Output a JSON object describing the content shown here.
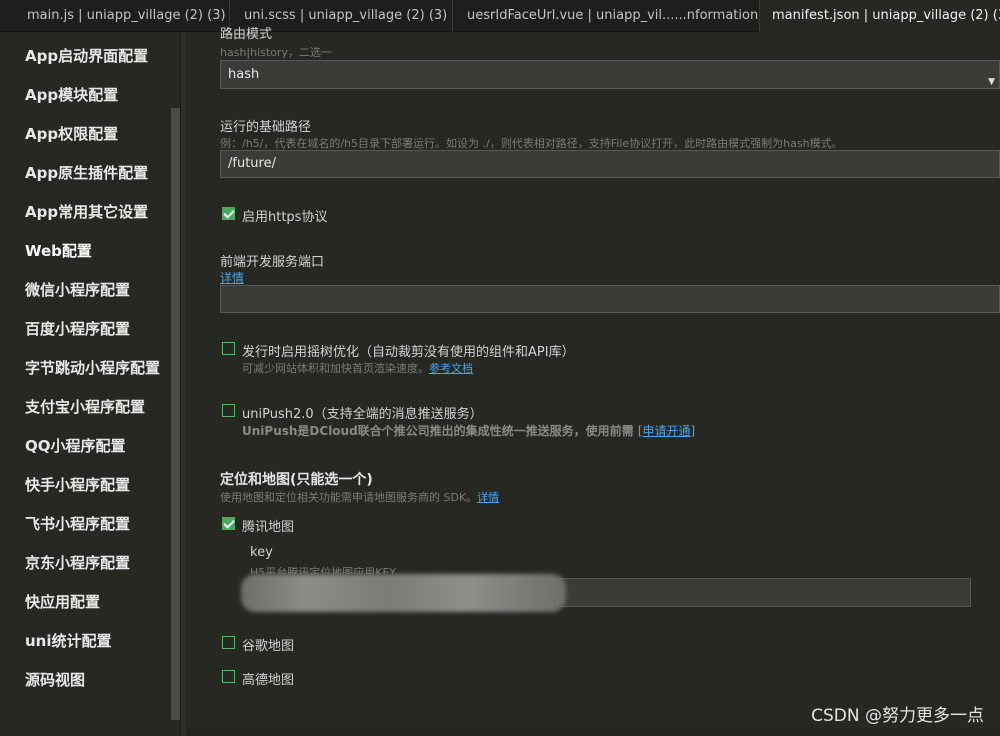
{
  "tabs": [
    {
      "label": "main.js | uniapp_village (2) (3)"
    },
    {
      "label": "uni.scss | uniapp_village (2) (3)"
    },
    {
      "label": "uesrIdFaceUrl.vue | uniapp_vil......nformation"
    },
    {
      "label": "manifest.json | uniapp_village (2) (3)"
    }
  ],
  "sidebar": {
    "items": [
      {
        "label": "App启动界面配置"
      },
      {
        "label": "App模块配置"
      },
      {
        "label": "App权限配置"
      },
      {
        "label": "App原生插件配置"
      },
      {
        "label": "App常用其它设置"
      },
      {
        "label": "Web配置"
      },
      {
        "label": "微信小程序配置"
      },
      {
        "label": "百度小程序配置"
      },
      {
        "label": "字节跳动小程序配置"
      },
      {
        "label": "支付宝小程序配置"
      },
      {
        "label": "QQ小程序配置"
      },
      {
        "label": "快手小程序配置"
      },
      {
        "label": "飞书小程序配置"
      },
      {
        "label": "京东小程序配置"
      },
      {
        "label": "快应用配置"
      },
      {
        "label": "uni统计配置"
      },
      {
        "label": "源码视图"
      }
    ]
  },
  "form": {
    "router_mode": {
      "label": "路由模式",
      "hint": "hash|history，二选一",
      "value": "hash"
    },
    "base_path": {
      "label": "运行的基础路径",
      "hint": "例：/h5/，代表在域名的/h5目录下部署运行。如设为 ./，则代表相对路径，支持File协议打开，此时路由模式强制为hash模式。",
      "value": "/future/"
    },
    "https": {
      "label": "启用https协议",
      "checked": true
    },
    "dev_port": {
      "label": "前端开发服务端口",
      "link": "详情",
      "value": ""
    },
    "tree_shaking": {
      "label": "发行时启用摇树优化（自动裁剪没有使用的组件和API库）",
      "hint": "可减少网站体积和加快首页渲染速度。",
      "link": "参考文档",
      "checked": false
    },
    "unipush": {
      "label": "uniPush2.0（支持全端的消息推送服务）",
      "hint": "UniPush是DCloud联合个推公司推出的集成性统一推送服务，使用前需",
      "link": "[申请开通]",
      "checked": false
    },
    "map": {
      "title": "定位和地图(只能选一个)",
      "hint": "使用地图和定位相关功能需申请地图服务商的 SDK。",
      "link": "详情",
      "tencent": {
        "label": "腾讯地图",
        "checked": true
      },
      "key_label": "key",
      "key_hint": "H5平台腾讯定位地图应用KEY",
      "google": {
        "label": "谷歌地图",
        "checked": false
      },
      "amap": {
        "label": "高德地图",
        "checked": false
      }
    }
  },
  "watermark": "CSDN @努力更多一点",
  "colors": {
    "background": "#272822",
    "checkbox_green": "#4aa85f",
    "link_blue": "#4aa3f0"
  }
}
